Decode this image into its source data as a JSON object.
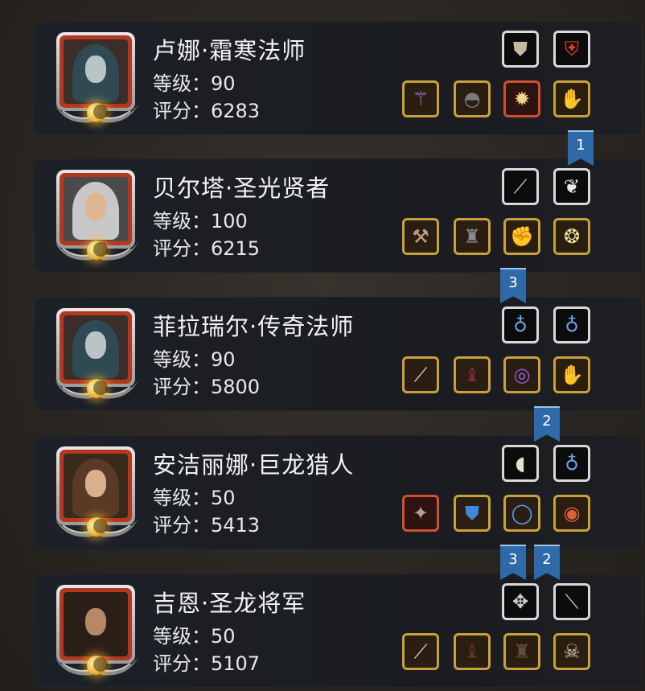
{
  "heroes": [
    {
      "name": "卢娜·霜寒法师",
      "level": "等级：90",
      "score": "评分：6283",
      "portrait": {
        "hood": "#2f4a52",
        "skin": "#b8c4c6",
        "bg": "#3b2d29"
      },
      "gear_top": [
        {
          "icon": "armor-piece-icon",
          "glyph": "⛊",
          "color": "#c9b8a0",
          "frame": "silver"
        },
        {
          "icon": "crest-shield-icon",
          "glyph": "⛨",
          "color": "#e04a2a",
          "frame": "silver"
        }
      ],
      "gear_bottom": [
        {
          "icon": "staff-icon",
          "glyph": "⚚",
          "color": "#b07af0",
          "frame": "gold"
        },
        {
          "icon": "chest-armor-icon",
          "glyph": "◓",
          "color": "#7a7a7a",
          "frame": "gold"
        },
        {
          "icon": "gem-amulet-icon",
          "glyph": "✹",
          "color": "#f0d28a",
          "frame": "red"
        },
        {
          "icon": "gloves-icon",
          "glyph": "✋",
          "color": "#c7a08a",
          "frame": "gold"
        }
      ]
    },
    {
      "name": "贝尔塔·圣光贤者",
      "level": "等级：100",
      "score": "评分：6215",
      "portrait": {
        "hood": "#c8c8c8",
        "skin": "#e0b690",
        "bg": "#4a4a4a"
      },
      "gear_top": [
        {
          "icon": "dagger-icon",
          "glyph": "⟋",
          "color": "#d0d0d0",
          "frame": "silver"
        },
        {
          "icon": "wing-icon",
          "glyph": "❦",
          "color": "#e8e8e8",
          "frame": "silver"
        }
      ],
      "gear_bottom": [
        {
          "icon": "hammer-icon",
          "glyph": "⚒",
          "color": "#c0a080",
          "frame": "gold"
        },
        {
          "icon": "robe-icon",
          "glyph": "♜",
          "color": "#8a8a8a",
          "frame": "gold"
        },
        {
          "icon": "gauntlet-icon",
          "glyph": "✊",
          "color": "#c9a85a",
          "frame": "gold"
        },
        {
          "icon": "pendant-icon",
          "glyph": "❂",
          "color": "#f0e0a0",
          "frame": "gold"
        }
      ]
    },
    {
      "name": "菲拉瑞尔·传奇法师",
      "level": "等级：90",
      "score": "评分：5800",
      "portrait": {
        "hood": "#2f4a52",
        "skin": "#b8c4c6",
        "bg": "#3b2d29"
      },
      "gear_top": [
        {
          "icon": "necklace-icon",
          "glyph": "♁",
          "color": "#6fa0e0",
          "frame": "silver"
        },
        {
          "icon": "necklace-icon",
          "glyph": "♁",
          "color": "#6fa0e0",
          "frame": "silver"
        }
      ],
      "gear_bottom": [
        {
          "icon": "wand-icon",
          "glyph": "⟋",
          "color": "#d8d8d8",
          "frame": "gold"
        },
        {
          "icon": "cloak-icon",
          "glyph": "♝",
          "color": "#7a2a40",
          "frame": "gold"
        },
        {
          "icon": "purple-ring-icon",
          "glyph": "◎",
          "color": "#9a5ae0",
          "frame": "gold"
        },
        {
          "icon": "gloves-icon",
          "glyph": "✋",
          "color": "#c7a08a",
          "frame": "gold"
        }
      ]
    },
    {
      "name": "安洁丽娜·巨龙猎人",
      "level": "等级：50",
      "score": "评分：5413",
      "portrait": {
        "hood": "#5a3a24",
        "skin": "#d9b08c",
        "bg": "#3a2a1c"
      },
      "gear_top": [
        {
          "icon": "fang-icon",
          "glyph": "◖",
          "color": "#e8e0d0",
          "frame": "silver"
        },
        {
          "icon": "necklace-icon",
          "glyph": "♁",
          "color": "#6fa0e0",
          "frame": "silver"
        }
      ],
      "gear_bottom": [
        {
          "icon": "pistol-icon",
          "glyph": "✦",
          "color": "#b0a090",
          "frame": "red"
        },
        {
          "icon": "blue-armor-icon",
          "glyph": "⛊",
          "color": "#3f8ad8",
          "frame": "gold"
        },
        {
          "icon": "sapphire-ring-icon",
          "glyph": "◯",
          "color": "#5aa0f0",
          "frame": "gold"
        },
        {
          "icon": "ruby-ring-icon",
          "glyph": "◉",
          "color": "#e0603a",
          "frame": "gold"
        }
      ]
    },
    {
      "name": "吉恩·圣龙将军",
      "level": "等级：50",
      "score": "评分：5107",
      "portrait": {
        "hood": "#2a1e16",
        "skin": "#b58866",
        "bg": "#2a2018"
      },
      "gear_top": [
        {
          "icon": "emblem-icon",
          "glyph": "✥",
          "color": "#d0d0d0",
          "frame": "silver"
        },
        {
          "icon": "blade-icon",
          "glyph": "⟍",
          "color": "#d0d0d0",
          "frame": "silver"
        }
      ],
      "gear_bottom": [
        {
          "icon": "spear-icon",
          "glyph": "⟋",
          "color": "#d8d8d8",
          "frame": "gold"
        },
        {
          "icon": "cape-icon",
          "glyph": "♝",
          "color": "#5a3020",
          "frame": "gold"
        },
        {
          "icon": "coat-icon",
          "glyph": "♜",
          "color": "#6a4a3a",
          "frame": "gold"
        },
        {
          "icon": "skull-mask-icon",
          "glyph": "☠",
          "color": "#d8c8b0",
          "frame": "gold"
        }
      ]
    }
  ],
  "banners": [
    "1",
    "3",
    "2",
    "3",
    "2"
  ]
}
